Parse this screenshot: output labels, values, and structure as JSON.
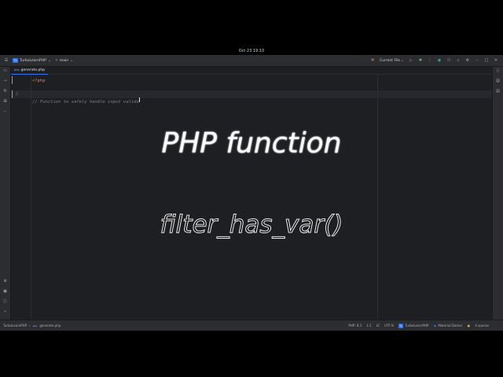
{
  "system": {
    "datetime": "Oct 23  19:10"
  },
  "toolbar": {
    "project_badge": "TL",
    "project_name": "TurboLearnPHP",
    "branch": "main",
    "run_config": "Current File"
  },
  "tab": {
    "file_name": "generate.php"
  },
  "editor": {
    "lines": [
      {
        "number": "1",
        "text": "<?php"
      },
      {
        "number": "2",
        "text": "// Function to safely handle input valida"
      }
    ]
  },
  "overlay": {
    "title": "PHP function",
    "function_name": "filter_has_var()"
  },
  "statusbar": {
    "breadcrumb_project": "TurboLearnPHP",
    "breadcrumb_sep": "›",
    "breadcrumb_file": "generate.php",
    "php_version": "PHP: 8.3",
    "position": "1:1",
    "line_ending": "LF",
    "encoding": "UTF-8",
    "project_badge": "TL",
    "project_name": "TurboLearnPHP",
    "framework": "Material Darker",
    "indent": "4 spaces"
  },
  "colors": {
    "accent": "#3574f0",
    "ide_background": "#1e1f22",
    "panel": "#2b2d30",
    "keyword": "#d0875a",
    "comment": "#7a7e85",
    "run_icon": "#e8804a",
    "debug_icon": "#5fb865"
  }
}
